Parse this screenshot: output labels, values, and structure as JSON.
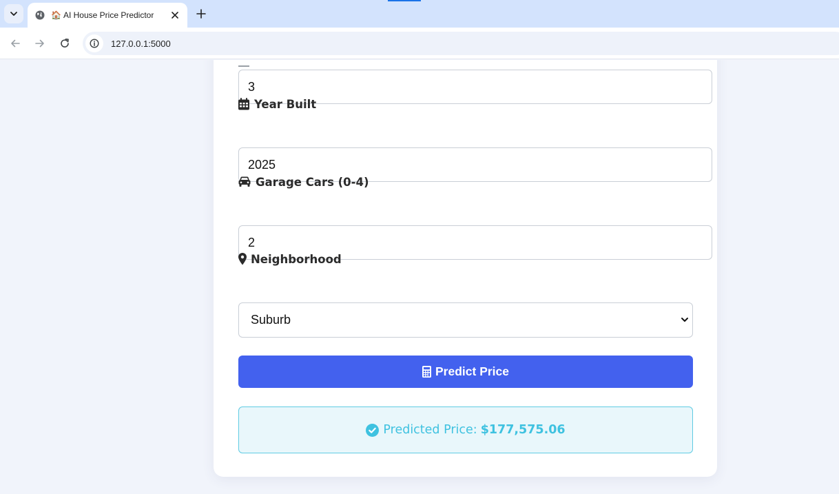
{
  "browser": {
    "tab_title": "AI House Price Predictor",
    "tab_emoji": "🏠",
    "url": "127.0.0.1:5000"
  },
  "form": {
    "bedrooms_value": "3",
    "year_built_label": "Year Built",
    "year_built_value": "2025",
    "garage_label": "Garage Cars (0-4)",
    "garage_value": "2",
    "neighborhood_label": "Neighborhood",
    "neighborhood_selected": "Suburb",
    "predict_button_label": "Predict Price"
  },
  "result": {
    "prefix": "Predicted Price:",
    "amount": "$177,575.06"
  },
  "icons": {
    "year_built": "calendar-icon",
    "garage": "car-icon",
    "neighborhood": "map-marker-icon",
    "predict": "calculator-icon",
    "result": "check-circle-icon"
  },
  "colors": {
    "primary_button": "#4361ee",
    "result_text": "#3fc2e0",
    "result_bg": "#e9f7fb",
    "result_border": "#5fcbe3",
    "page_bg": "#f1f4fb"
  }
}
